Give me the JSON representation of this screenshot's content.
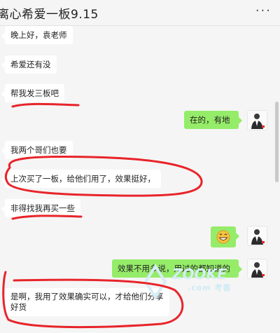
{
  "header": {
    "title": "离心希爱一板9.15",
    "more_icon": "more-icon"
  },
  "messages": [
    {
      "side": "left",
      "text": "晚上好，袁老师"
    },
    {
      "side": "left",
      "text": "希爱还有没"
    },
    {
      "side": "left",
      "text": "帮我发三板吧"
    },
    {
      "side": "right",
      "text": "在的，有地"
    },
    {
      "side": "left",
      "text": "我两个哥们也要"
    },
    {
      "side": "left",
      "text": "上次买了一板，给他们用了，效果挺好，"
    },
    {
      "side": "left",
      "text": "非得找我再买一些"
    },
    {
      "side": "right",
      "text": "",
      "emoji": "grinning-face-emoji"
    },
    {
      "side": "right",
      "text": "效果不用多说，用过的都知道的"
    },
    {
      "side": "left",
      "text_lines": [
        "是啊，我用了效果确实可以，才给他们分享",
        "好货"
      ]
    }
  ],
  "watermark": {
    "text": ".com 考香"
  },
  "colors": {
    "sent_bubble": "#95ec69",
    "received_bubble": "#ffffff",
    "annotation": "#e8242a"
  }
}
